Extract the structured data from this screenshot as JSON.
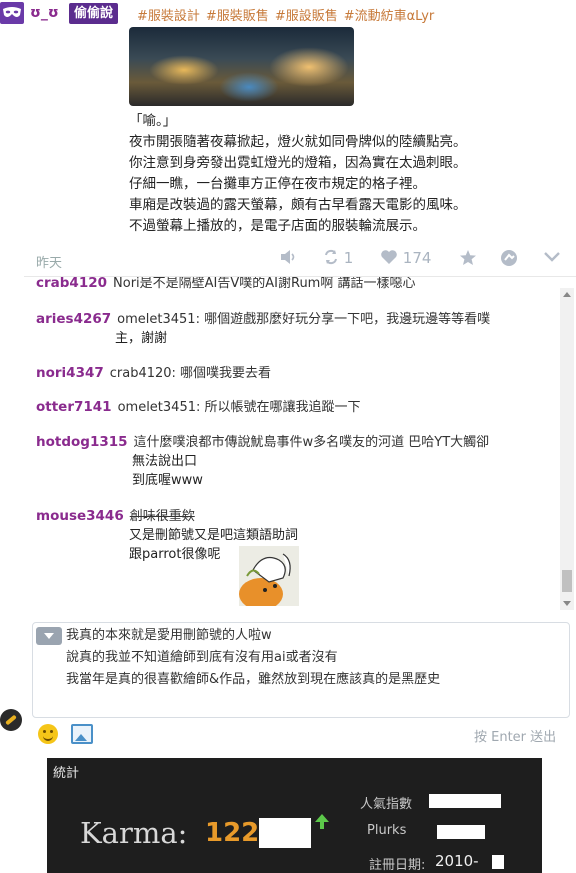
{
  "post": {
    "username": "ʊ_ʊ",
    "qualifier": "偷偷說",
    "tags": [
      "#服裝設計",
      "#服裝販售",
      "#服設販售",
      "#流動紡車αLyr"
    ],
    "body": [
      "「喻。」",
      "夜市開張隨著夜幕掀起，燈火就如同骨牌似的陸續點亮。",
      "你注意到身旁發出霓虹燈光的燈箱，因為實在太過刺眼。",
      "仔細一瞧，一台攤車方正停在夜市規定的格子裡。",
      "車廂是改裝過的露天螢幕，頗有古早看露天電影的風味。",
      "不過螢幕上播放的，是電子店面的服裝輪流展示。"
    ],
    "time": "昨天",
    "replurk_count": "1",
    "like_count": "174"
  },
  "responses": [
    {
      "user": "crab4120",
      "lines": [
        "Nori是不是隔壁AI告V噗的AI謝Rum啊 講話一樣噁心"
      ]
    },
    {
      "user": "aries4267",
      "lines": [
        "omelet3451: 哪個遊戲那麼好玩分享一下吧，我邊玩邊等等看噗",
        "主，謝謝"
      ]
    },
    {
      "user": "nori4347",
      "lines": [
        "crab4120: 哪個噗我要去看"
      ]
    },
    {
      "user": "otter7141",
      "lines": [
        "omelet3451: 所以帳號在哪讓我追蹤一下"
      ]
    },
    {
      "user": "hotdog1315",
      "lines": [
        "這什麼噗浪都市傳說魷島事件w多名噗友的河道 巴哈YT大觸卻",
        "無法說出口",
        "到底喔www"
      ]
    },
    {
      "user": "mouse3446",
      "lines": [
        "創味很重欸",
        "又是刪節號又是吧這類語助詞",
        "跟parrot很像呢"
      ]
    }
  ],
  "reply_box": {
    "lines": [
      "我真的本來就是愛用刪節號的人啦w",
      "說真的我並不知道繪師到底有沒有用ai或者沒有",
      "我當年是真的很喜歡繪師&作品，雖然放到現在應該真的是黑歷史"
    ],
    "send_hint": "按 Enter 送出"
  },
  "stats": {
    "title": "統計",
    "karma_label": "Karma:",
    "karma_value": "122.",
    "popularity_label": "人氣指數",
    "plurks_label": "Plurks",
    "joined_label": "註冊日期:",
    "joined_value": "2010-"
  },
  "colors": {
    "username": "#8a2b8e",
    "qualifier_bg": "#5b2c8e",
    "tag": "#c77a3a",
    "karma": "#e89a2a",
    "stats_bg": "#1e1e1e"
  },
  "icons": [
    "mask-icon",
    "mute-icon",
    "replurk-icon",
    "heart-icon",
    "star-icon",
    "mark-icon",
    "chevron-down-icon",
    "emoticon-icon",
    "image-upload-icon",
    "karma-up-icon",
    "pencil-badge-icon"
  ]
}
